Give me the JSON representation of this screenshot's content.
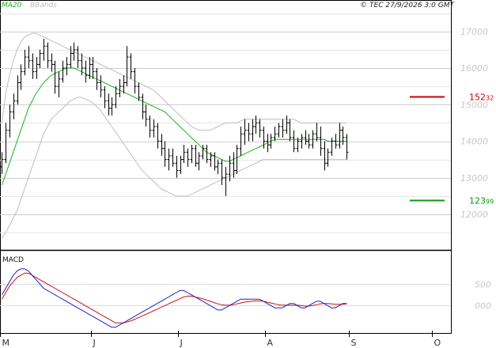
{
  "chart_data": {
    "type": "line",
    "header": {
      "ma_label": "MA20",
      "bb_label": "BBands",
      "copyright": "© TEC 27/9/2026 3:0 GMT",
      "ma_color": "#19b219",
      "bb_color": "#bdbdbd"
    },
    "price_panel": {
      "ylim": [
        11050,
        17600
      ],
      "yticks": [
        {
          "value": 12000,
          "label": "12000"
        },
        {
          "value": 13000,
          "label": "13000"
        },
        {
          "value": 14000,
          "label": "14000"
        },
        {
          "value": 15000,
          "label": "15000"
        },
        {
          "value": 16000,
          "label": "16000"
        },
        {
          "value": 17000,
          "label": "17000"
        }
      ],
      "resistance": {
        "value": 15232,
        "label_main": "152",
        "label_small": "32",
        "color": "#cc0000"
      },
      "support": {
        "value": 12399,
        "label_main": "123",
        "label_small": "99",
        "color": "#0a9a0a"
      }
    },
    "macd_panel": {
      "title": "MACD",
      "ylim": [
        -650,
        1250
      ],
      "yticks": [
        {
          "value": 0,
          "label": "000"
        },
        {
          "value": 500,
          "label": "500"
        }
      ],
      "macd_color": "#1d1dd6",
      "signal_color": "#cc1111"
    },
    "x_labels": [
      "M",
      "J",
      "J",
      "A",
      "S",
      "O"
    ],
    "x_label_index": [
      0,
      24,
      47,
      70,
      92,
      114
    ],
    "n_days": 119,
    "candles": [
      [
        13300,
        13700,
        13100,
        13500
      ],
      [
        13500,
        14500,
        13400,
        14300
      ],
      [
        14300,
        15000,
        14100,
        14800
      ],
      [
        14800,
        15300,
        14600,
        15100
      ],
      [
        15100,
        15800,
        15000,
        15600
      ],
      [
        15600,
        16100,
        15400,
        15900
      ],
      [
        15900,
        16500,
        15800,
        16300
      ],
      [
        16300,
        16600,
        16000,
        16200
      ],
      [
        16200,
        16400,
        15700,
        15900
      ],
      [
        15900,
        16300,
        15700,
        16100
      ],
      [
        16100,
        16500,
        16000,
        16400
      ],
      [
        16400,
        16800,
        16200,
        16600
      ],
      [
        16600,
        16700,
        16000,
        16200
      ],
      [
        16200,
        16400,
        15900,
        16100
      ],
      [
        16100,
        16200,
        15300,
        15500
      ],
      [
        15500,
        15900,
        15200,
        15700
      ],
      [
        15700,
        16200,
        15600,
        16000
      ],
      [
        16000,
        16300,
        15800,
        16100
      ],
      [
        16100,
        16600,
        16000,
        16400
      ],
      [
        16400,
        16700,
        16200,
        16500
      ],
      [
        16500,
        16600,
        16000,
        16200
      ],
      [
        16200,
        16400,
        15800,
        16000
      ],
      [
        16000,
        16200,
        15600,
        15800
      ],
      [
        15800,
        16300,
        15700,
        16100
      ],
      [
        16100,
        16300,
        15700,
        15900
      ],
      [
        15900,
        16000,
        15400,
        15600
      ],
      [
        15600,
        15800,
        15200,
        15400
      ],
      [
        15400,
        15500,
        14900,
        15100
      ],
      [
        15100,
        15300,
        14700,
        14900
      ],
      [
        14900,
        15200,
        14700,
        15000
      ],
      [
        15000,
        15500,
        14900,
        15300
      ],
      [
        15300,
        15700,
        15200,
        15500
      ],
      [
        15500,
        15800,
        15300,
        15600
      ],
      [
        15600,
        16600,
        15500,
        16300
      ],
      [
        16300,
        16400,
        15700,
        15900
      ],
      [
        15900,
        16000,
        15300,
        15500
      ],
      [
        15500,
        15600,
        15100,
        15200
      ],
      [
        15200,
        15300,
        14600,
        14800
      ],
      [
        14800,
        15000,
        14400,
        14600
      ],
      [
        14600,
        14700,
        14100,
        14300
      ],
      [
        14300,
        14600,
        14100,
        14400
      ],
      [
        14400,
        14500,
        13800,
        14000
      ],
      [
        14000,
        14200,
        13600,
        13800
      ],
      [
        13800,
        14000,
        13300,
        13500
      ],
      [
        13500,
        13800,
        13200,
        13600
      ],
      [
        13600,
        13800,
        13300,
        13400
      ],
      [
        13400,
        13600,
        13000,
        13200
      ],
      [
        13200,
        13600,
        13100,
        13500
      ],
      [
        13500,
        13900,
        13400,
        13700
      ],
      [
        13700,
        13800,
        13300,
        13500
      ],
      [
        13500,
        13900,
        13400,
        13800
      ],
      [
        13800,
        13900,
        13300,
        13400
      ],
      [
        13400,
        13700,
        13200,
        13600
      ],
      [
        13600,
        13900,
        13500,
        13800
      ],
      [
        13800,
        13900,
        13400,
        13500
      ],
      [
        13500,
        13700,
        13300,
        13600
      ],
      [
        13600,
        13700,
        13200,
        13300
      ],
      [
        13300,
        13500,
        13100,
        13400
      ],
      [
        13400,
        13500,
        12800,
        13000
      ],
      [
        13000,
        13300,
        12500,
        13100
      ],
      [
        13100,
        13600,
        12900,
        13400
      ],
      [
        13400,
        13700,
        13000,
        13200
      ],
      [
        13200,
        13900,
        13100,
        13800
      ],
      [
        13800,
        14400,
        13600,
        14200
      ],
      [
        14200,
        14600,
        13900,
        14300
      ],
      [
        14300,
        14500,
        14000,
        14200
      ],
      [
        14200,
        14600,
        14000,
        14400
      ],
      [
        14400,
        14700,
        14200,
        14500
      ],
      [
        14500,
        14600,
        14100,
        14300
      ],
      [
        14300,
        14400,
        13800,
        14000
      ],
      [
        14000,
        14200,
        13700,
        13900
      ],
      [
        13900,
        14200,
        13800,
        14100
      ],
      [
        14100,
        14400,
        14000,
        14200
      ],
      [
        14200,
        14500,
        14100,
        14400
      ],
      [
        14400,
        14600,
        14100,
        14300
      ],
      [
        14300,
        14700,
        14200,
        14500
      ],
      [
        14500,
        14600,
        14000,
        14100
      ],
      [
        14100,
        14300,
        13700,
        13800
      ],
      [
        13800,
        14100,
        13700,
        14000
      ],
      [
        14000,
        14200,
        13800,
        14100
      ],
      [
        14100,
        14300,
        13900,
        14000
      ],
      [
        14000,
        14200,
        13800,
        13900
      ],
      [
        13900,
        14300,
        13800,
        14200
      ],
      [
        14200,
        14500,
        14000,
        14100
      ],
      [
        14100,
        14400,
        13600,
        13800
      ],
      [
        13800,
        14000,
        13200,
        13400
      ],
      [
        13400,
        13800,
        13300,
        13700
      ],
      [
        13700,
        14100,
        13600,
        14000
      ],
      [
        14000,
        14200,
        13800,
        13900
      ],
      [
        13900,
        14500,
        13800,
        14300
      ],
      [
        14300,
        14400,
        13900,
        14100
      ],
      [
        14100,
        14200,
        13500,
        13700
      ]
    ],
    "bb_upper": [
      14500,
      15300,
      15800,
      16200,
      16500,
      16700,
      16850,
      16900,
      16950,
      16950,
      16900,
      16850,
      16800,
      16750,
      16700,
      16650,
      16600,
      16550,
      16500,
      16450,
      16400,
      16350,
      16300,
      16250,
      16200,
      16150,
      16100,
      16050,
      16000,
      15950,
      15900,
      15850,
      15800,
      15750,
      15700,
      15650,
      15600,
      15550,
      15500,
      15450,
      15400,
      15300,
      15200,
      15100,
      15000,
      14900,
      14800,
      14700,
      14600,
      14500,
      14400,
      14350,
      14300,
      14300,
      14300,
      14300,
      14350,
      14400,
      14450,
      14500,
      14500,
      14500,
      14500,
      14550,
      14600,
      14600,
      14600,
      14600,
      14600,
      14600,
      14600,
      14600,
      14600,
      14600,
      14600,
      14600,
      14600,
      14600,
      14550,
      14500,
      14500,
      14500,
      14500,
      14500,
      14500,
      14500,
      14500,
      14500,
      14500,
      14500,
      14500,
      14500
    ],
    "bb_lower": [
      11350,
      11500,
      11700,
      11900,
      12100,
      12400,
      12700,
      13000,
      13300,
      13600,
      13900,
      14200,
      14400,
      14600,
      14700,
      14800,
      14900,
      15000,
      15100,
      15150,
      15200,
      15200,
      15150,
      15100,
      15050,
      14950,
      14850,
      14700,
      14550,
      14400,
      14250,
      14100,
      13950,
      13800,
      13650,
      13500,
      13350,
      13200,
      13100,
      13000,
      12900,
      12800,
      12700,
      12650,
      12600,
      12550,
      12500,
      12500,
      12500,
      12500,
      12550,
      12600,
      12650,
      12700,
      12750,
      12800,
      12850,
      12900,
      12950,
      13000,
      13050,
      13100,
      13150,
      13200,
      13250,
      13300,
      13350,
      13400,
      13450,
      13500,
      13500,
      13500,
      13500,
      13500,
      13500,
      13500,
      13500,
      13500,
      13500,
      13500,
      13500,
      13500,
      13500,
      13500,
      13500,
      13500,
      13500,
      13500,
      13500,
      13500,
      13500,
      13500
    ],
    "ma20": [
      12800,
      13100,
      13400,
      13700,
      14000,
      14300,
      14600,
      14900,
      15100,
      15300,
      15450,
      15600,
      15700,
      15800,
      15850,
      15900,
      15950,
      16000,
      16000,
      16000,
      15950,
      15900,
      15850,
      15800,
      15750,
      15700,
      15650,
      15600,
      15550,
      15500,
      15450,
      15400,
      15350,
      15300,
      15250,
      15200,
      15150,
      15100,
      15050,
      15000,
      14950,
      14900,
      14850,
      14800,
      14700,
      14600,
      14500,
      14400,
      14300,
      14200,
      14100,
      14000,
      13900,
      13800,
      13700,
      13650,
      13600,
      13550,
      13500,
      13450,
      13450,
      13500,
      13550,
      13600,
      13650,
      13700,
      13750,
      13800,
      13850,
      13900,
      13950,
      14000,
      14050,
      14050,
      14050,
      14050,
      14050,
      14050,
      14050,
      14050,
      14050,
      14050,
      14050,
      14050,
      14050,
      14050,
      14000,
      14000,
      14000,
      14000,
      14000,
      14000
    ],
    "macd": [
      250,
      400,
      550,
      700,
      800,
      850,
      850,
      800,
      700,
      600,
      500,
      400,
      350,
      300,
      250,
      200,
      150,
      100,
      50,
      0,
      -50,
      -100,
      -150,
      -200,
      -250,
      -300,
      -350,
      -400,
      -450,
      -500,
      -500,
      -450,
      -400,
      -350,
      -300,
      -250,
      -200,
      -150,
      -100,
      -50,
      0,
      50,
      100,
      150,
      200,
      250,
      300,
      350,
      350,
      300,
      250,
      200,
      150,
      100,
      50,
      0,
      -50,
      -100,
      -100,
      -50,
      0,
      50,
      100,
      150,
      150,
      150,
      150,
      150,
      150,
      100,
      50,
      0,
      -50,
      -50,
      -50,
      0,
      50,
      50,
      0,
      -50,
      -50,
      0,
      50,
      100,
      100,
      50,
      0,
      -50,
      -50,
      0,
      50,
      50
    ],
    "signal": [
      150,
      300,
      450,
      550,
      650,
      700,
      750,
      750,
      700,
      650,
      600,
      550,
      500,
      450,
      400,
      350,
      300,
      250,
      200,
      150,
      100,
      50,
      0,
      -50,
      -100,
      -150,
      -200,
      -250,
      -300,
      -350,
      -400,
      -400,
      -400,
      -380,
      -350,
      -320,
      -280,
      -240,
      -200,
      -160,
      -120,
      -80,
      -40,
      0,
      40,
      80,
      120,
      160,
      200,
      220,
      220,
      200,
      180,
      160,
      130,
      100,
      70,
      40,
      20,
      10,
      10,
      20,
      40,
      60,
      80,
      90,
      100,
      110,
      110,
      100,
      80,
      60,
      40,
      20,
      10,
      10,
      10,
      10,
      10,
      0,
      -10,
      -10,
      0,
      20,
      40,
      50,
      50,
      40,
      30,
      30,
      30,
      40
    ]
  }
}
